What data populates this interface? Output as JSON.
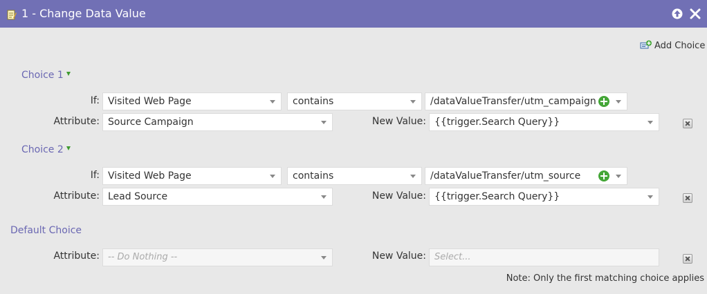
{
  "window": {
    "title": "1 - Change Data Value"
  },
  "toolbar": {
    "add_choice_label": "Add Choice"
  },
  "labels": {
    "if": "If:",
    "attribute": "Attribute:",
    "new_value": "New Value:"
  },
  "choices": [
    {
      "heading": "Choice 1",
      "if_field": "Visited Web Page",
      "operator": "contains",
      "if_value": "/dataValueTransfer/utm_campaign",
      "attribute": "Source Campaign",
      "new_value": "{{trigger.Search Query}}"
    },
    {
      "heading": "Choice 2",
      "if_field": "Visited Web Page",
      "operator": "contains",
      "if_value": "/dataValueTransfer/utm_source",
      "attribute": "Lead Source",
      "new_value": "{{trigger.Search Query}}"
    }
  ],
  "default_choice": {
    "heading": "Default Choice",
    "attribute": "-- Do Nothing --",
    "new_value_placeholder": "Select..."
  },
  "note": "Note: Only the first matching choice applies",
  "colors": {
    "header": "#7170b5",
    "section_heading": "#6a67b2",
    "plus": "#44a637"
  }
}
